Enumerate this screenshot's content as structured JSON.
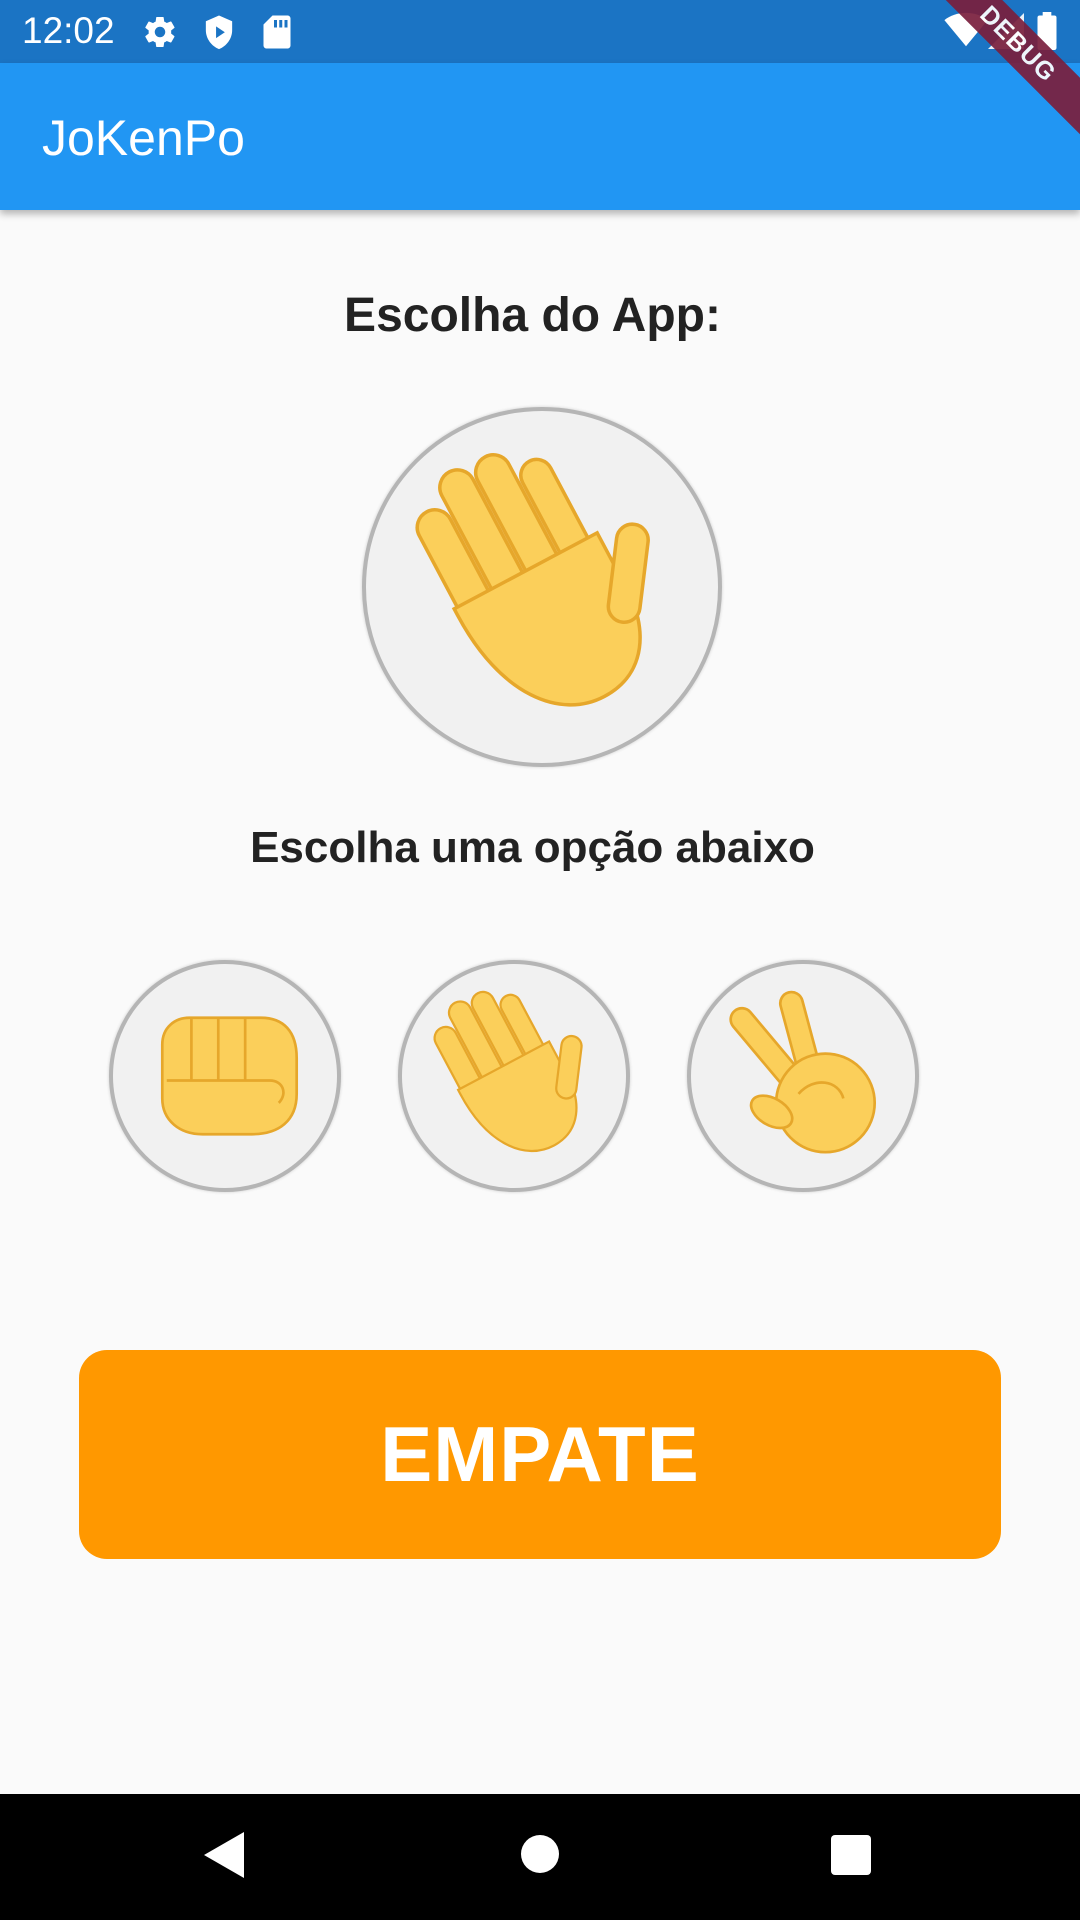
{
  "status_bar": {
    "time": "12:02",
    "icons": [
      "gear-icon",
      "shield-icon",
      "sd-card-icon",
      "wifi-icon",
      "signal-icon",
      "battery-icon"
    ],
    "color": "#1b74c4"
  },
  "app_bar": {
    "title": "JoKenPo",
    "color": "#2196f3"
  },
  "debug_banner": "DEBUG",
  "main": {
    "app_choice_heading": "Escolha do App:",
    "app_choice_icon": "paper-hand-icon",
    "options_heading": "Escolha uma opção abaixo",
    "options": [
      {
        "name": "rock",
        "icon": "rock-fist-icon"
      },
      {
        "name": "paper",
        "icon": "paper-hand-icon"
      },
      {
        "name": "scissors",
        "icon": "scissors-hand-icon"
      }
    ],
    "result_label": "EMPATE",
    "result_color": "#ff9800"
  },
  "nav_bar": {
    "icons": [
      "back-icon",
      "home-icon",
      "recents-icon"
    ]
  }
}
